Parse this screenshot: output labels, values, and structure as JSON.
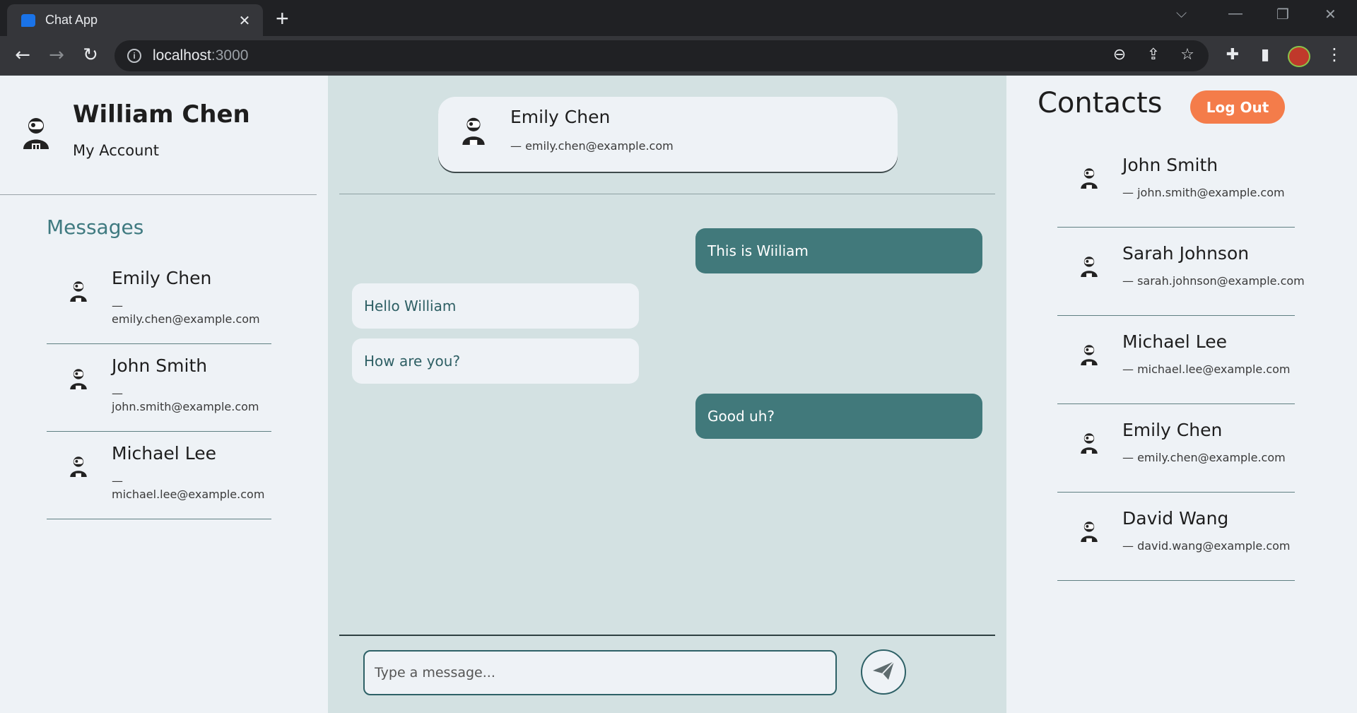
{
  "browser": {
    "tab_title": "Chat App",
    "tab_close": "✕",
    "new_tab": "+",
    "url_host": "localhost",
    "url_port": ":3000"
  },
  "me": {
    "name": "William Chen",
    "account_label": "My Account"
  },
  "messages_panel": {
    "title": "Messages",
    "conversations": [
      {
        "name": "Emily Chen",
        "email": "— emily.chen@example.com"
      },
      {
        "name": "John Smith",
        "email": "— john.smith@example.com"
      },
      {
        "name": "Michael Lee",
        "email": "— michael.lee@example.com"
      }
    ]
  },
  "chat": {
    "header": {
      "name": "Emily Chen",
      "email": "— emily.chen@example.com"
    },
    "messages": [
      {
        "direction": "out",
        "text": "This is Wiiliam"
      },
      {
        "direction": "in",
        "text": "Hello William"
      },
      {
        "direction": "in",
        "text": "How are you?"
      },
      {
        "direction": "out",
        "text": "Good uh?"
      }
    ],
    "input_placeholder": "Type a message..."
  },
  "contacts": {
    "title": "Contacts",
    "logout_label": "Log Out",
    "items": [
      {
        "name": "John Smith",
        "email": "— john.smith@example.com"
      },
      {
        "name": "Sarah Johnson",
        "email": "— sarah.johnson@example.com"
      },
      {
        "name": "Michael Lee",
        "email": "— michael.lee@example.com"
      },
      {
        "name": "Emily Chen",
        "email": "— emily.chen@example.com"
      },
      {
        "name": "David Wang",
        "email": "— david.wang@example.com"
      }
    ]
  },
  "colors": {
    "accent_teal": "#41797b",
    "logout_orange": "#f47c4a",
    "panel_bg": "#eef2f6",
    "chat_bg": "#d3e1e2"
  }
}
